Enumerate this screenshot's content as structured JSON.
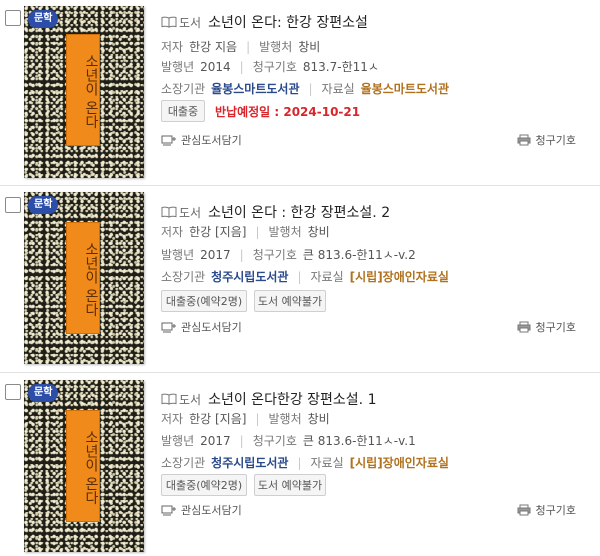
{
  "results": [
    {
      "genre": "문학",
      "cover_text": "소년이 온다",
      "type": "도서",
      "title": "소년이 온다: 한강 장편소설",
      "author_label": "저자",
      "author": "한강 지음",
      "publisher_label": "발행처",
      "publisher": "창비",
      "year_label": "발행년",
      "year": "2014",
      "call_label": "청구기호",
      "call": "813.7-한11ㅅ",
      "library_label": "소장기관",
      "library": "율봉스마트도서관",
      "room_label": "자료실",
      "room": "율봉스마트도서관",
      "status": "대출중",
      "due": "반납예정일 : 2024-10-21",
      "wish": "관심도서담기",
      "print": "청구기호"
    },
    {
      "genre": "문학",
      "cover_text": "소년이 온다",
      "type": "도서",
      "title": "소년이 온다 : 한강 장편소설. 2",
      "author_label": "저자",
      "author": "한강 [지음]",
      "publisher_label": "발행처",
      "publisher": "창비",
      "year_label": "발행년",
      "year": "2017",
      "call_label": "청구기호",
      "call": "큰 813.6-한11ㅅ-v.2",
      "library_label": "소장기관",
      "library": "청주시립도서관",
      "room_label": "자료실",
      "room": "[시립]장애인자료실",
      "status": "대출중(예약2명)",
      "reserve": "도서 예약불가",
      "wish": "관심도서담기",
      "print": "청구기호"
    },
    {
      "genre": "문학",
      "cover_text": "소년이 온다",
      "type": "도서",
      "title": "소년이 온다한강 장편소설. 1",
      "author_label": "저자",
      "author": "한강 [지음]",
      "publisher_label": "발행처",
      "publisher": "창비",
      "year_label": "발행년",
      "year": "2017",
      "call_label": "청구기호",
      "call": "큰 813.6-한11ㅅ-v.1",
      "library_label": "소장기관",
      "library": "청주시립도서관",
      "room_label": "자료실",
      "room": "[시립]장애인자료실",
      "status": "대출중(예약2명)",
      "reserve": "도서 예약불가",
      "wish": "관심도서담기",
      "print": "청구기호"
    }
  ],
  "colors": {
    "genre_badge": "#2c4ea8",
    "library": "#2a4a8c",
    "room": "#b0721e",
    "due": "#d9262c",
    "cover_panel": "#f08a1a"
  },
  "icons": {
    "type": "book-icon",
    "wish": "shelf-add-icon",
    "print": "printer-icon"
  }
}
